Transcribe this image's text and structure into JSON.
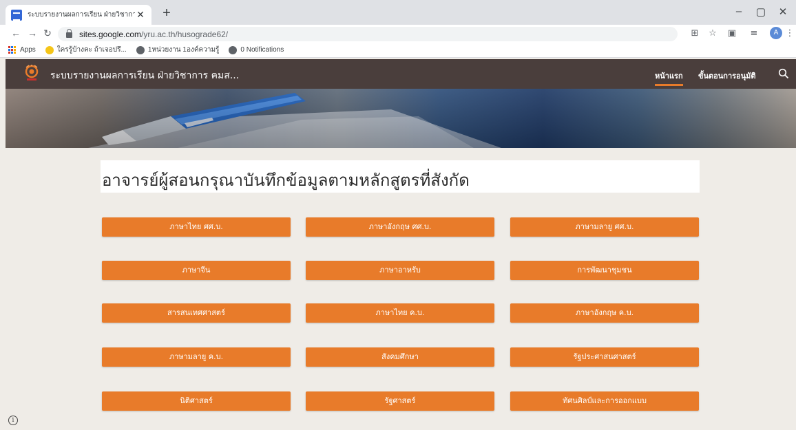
{
  "browser": {
    "tab_title": "ระบบรายงานผลการเรียน ฝ่ายวิชาการ - ",
    "tab_close": "✕",
    "new_tab": "+",
    "url_host": "sites.google.com",
    "url_path": "/yru.ac.th/husograde62/",
    "profile_initial": "A",
    "bookmarks": [
      {
        "label": "Apps",
        "icon": "apps-grid-icon"
      },
      {
        "label": "ใครรู้บ้างคะ ถ้าเจอปรึ...",
        "icon": "emoji-icon"
      },
      {
        "label": "1หน่วยงาน 1องค์ความรู้",
        "icon": "globe-icon"
      },
      {
        "label": "0 Notifications",
        "icon": "globe-icon"
      }
    ]
  },
  "site": {
    "title": "ระบบรายงานผลการเรียน ฝ่ายวิชาการ คมส...",
    "nav": [
      {
        "label": "หน้าแรก",
        "active": true
      },
      {
        "label": "ขั้นตอนการอนุมัติ",
        "active": false
      }
    ],
    "accent_color": "#e87b2a",
    "header_color": "#4a3e3c"
  },
  "main": {
    "heading": "อาจารย์ผู้สอนกรุณาบันทึกข้อมูลตามหลักสูตรที่สังกัด",
    "buttons": [
      "ภาษาไทย ศศ.บ.",
      "ภาษาอังกฤษ ศศ.บ.",
      "ภาษามลายู ศศ.บ.",
      "ภาษาจีน",
      "ภาษาอาหรับ",
      "การพัฒนาชุมชน",
      "สารสนเทศศาสตร์",
      "ภาษาไทย ค.บ.",
      "ภาษาอังกฤษ ค.บ.",
      "ภาษามลายู ค.บ.",
      "สังคมศึกษา",
      "รัฐประศาสนศาสตร์",
      "นิติศาสตร์",
      "รัฐศาสตร์",
      "ทัศนศิลป์และการออกแบบ"
    ]
  },
  "footer": {
    "info_glyph": "i"
  }
}
